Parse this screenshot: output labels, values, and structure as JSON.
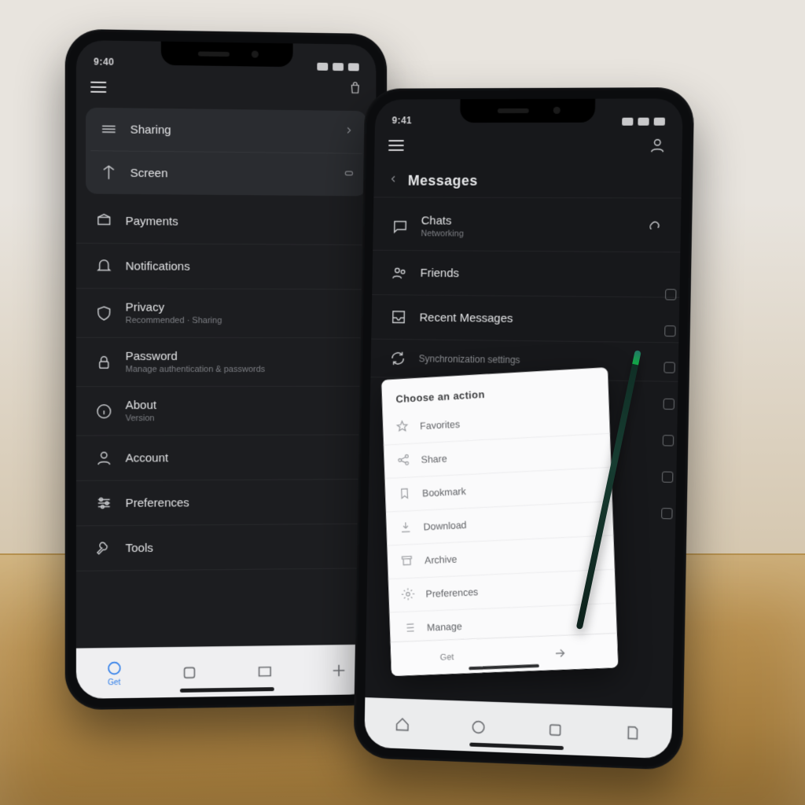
{
  "phoneA": {
    "status_time": "9:40",
    "header": {
      "item1": "Sharing",
      "item2": "Screen"
    },
    "list": [
      {
        "label": "Payments",
        "sub": ""
      },
      {
        "label": "Notifications",
        "sub": ""
      },
      {
        "label": "Privacy",
        "sub": "Recommended · Sharing"
      },
      {
        "label": "Password",
        "sub": "Manage authentication & passwords"
      },
      {
        "label": "About",
        "sub": "Version"
      },
      {
        "label": "Account",
        "sub": ""
      },
      {
        "label": "Preferences",
        "sub": ""
      },
      {
        "label": "Tools",
        "sub": ""
      }
    ],
    "tabs": [
      "Get",
      "",
      "",
      ""
    ]
  },
  "phoneB": {
    "status_time": "9:41",
    "title": "Messages",
    "rows": [
      {
        "label": "Chats",
        "sub": "Networking"
      },
      {
        "label": "Friends",
        "sub": ""
      },
      {
        "label": "Recent Messages",
        "sub": ""
      }
    ],
    "section_label": "Synchronization settings",
    "popup_title": "Choose an action",
    "popup_items": [
      "Favorites",
      "Share",
      "Bookmark",
      "Download",
      "Archive",
      "Preferences",
      "Manage"
    ],
    "popup_bar": [
      "Get",
      ""
    ],
    "tabs": [
      "",
      "",
      "",
      ""
    ]
  }
}
